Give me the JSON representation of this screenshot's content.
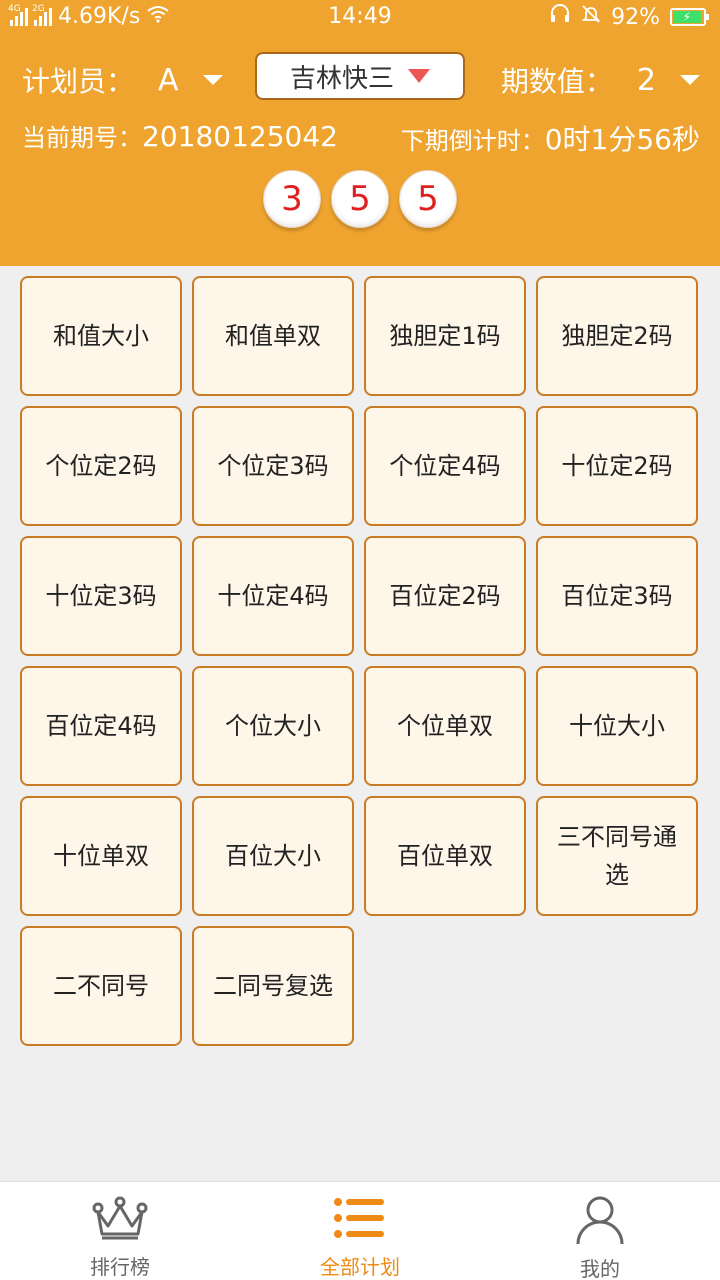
{
  "status": {
    "net1": "4G",
    "net2": "2G",
    "speed": "4.69K/s",
    "time": "14:49",
    "battery": "92%",
    "battery_level": 0.92
  },
  "header": {
    "planner_label": "计划员：",
    "planner_value": "A",
    "lottery_select": "吉林快三",
    "period_label": "期数值：",
    "period_value": "2",
    "current_issue_label": "当前期号：",
    "current_issue": "20180125042",
    "countdown_label": "下期倒计时：",
    "countdown": "0时1分56秒",
    "balls": [
      "3",
      "5",
      "5"
    ]
  },
  "plans": [
    "和值大小",
    "和值单双",
    "独胆定1码",
    "独胆定2码",
    "个位定2码",
    "个位定3码",
    "个位定4码",
    "十位定2码",
    "十位定3码",
    "十位定4码",
    "百位定2码",
    "百位定3码",
    "百位定4码",
    "个位大小",
    "个位单双",
    "十位大小",
    "十位单双",
    "百位大小",
    "百位单双",
    "三不同号通选",
    "二不同号",
    "二同号复选"
  ],
  "nav": {
    "items": [
      {
        "label": "排行榜",
        "icon": "crown-icon"
      },
      {
        "label": "全部计划",
        "icon": "list-icon"
      },
      {
        "label": "我的",
        "icon": "user-icon"
      }
    ],
    "active_color": "#ef8a17"
  },
  "colors": {
    "header": "#efa42f",
    "cell_border": "#c97c24",
    "cell_bg": "#fff6ea",
    "ball_text": "#e02020"
  }
}
